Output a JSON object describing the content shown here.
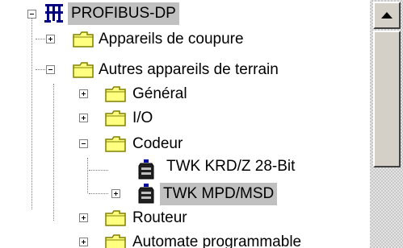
{
  "tree": {
    "root": {
      "label": "PROFIBUS-DP",
      "expanded": true,
      "selected": true
    },
    "nodes": [
      {
        "label": "Appareils de coupure",
        "expanded": false
      },
      {
        "label": "Autres appareils de terrain",
        "expanded": true
      },
      {
        "label": "Général",
        "expanded": false
      },
      {
        "label": "I/O",
        "expanded": false
      },
      {
        "label": "Codeur",
        "expanded": true
      },
      {
        "label": "TWK KRD/Z 28-Bit"
      },
      {
        "label": "TWK MPD/MSD",
        "expanded": false,
        "selected": true
      },
      {
        "label": "Routeur",
        "expanded": false
      },
      {
        "label": "Automate programmable",
        "expanded": false
      }
    ]
  },
  "colors": {
    "folder": "#ffff80",
    "folder_outline": "#808000",
    "selection": "#c0c0c0",
    "network_icon": "#000080"
  },
  "icons": {
    "root": "network-icon",
    "folder": "folder-icon",
    "device": "encoder-device-icon",
    "scroll_up": "arrow-up-icon"
  }
}
